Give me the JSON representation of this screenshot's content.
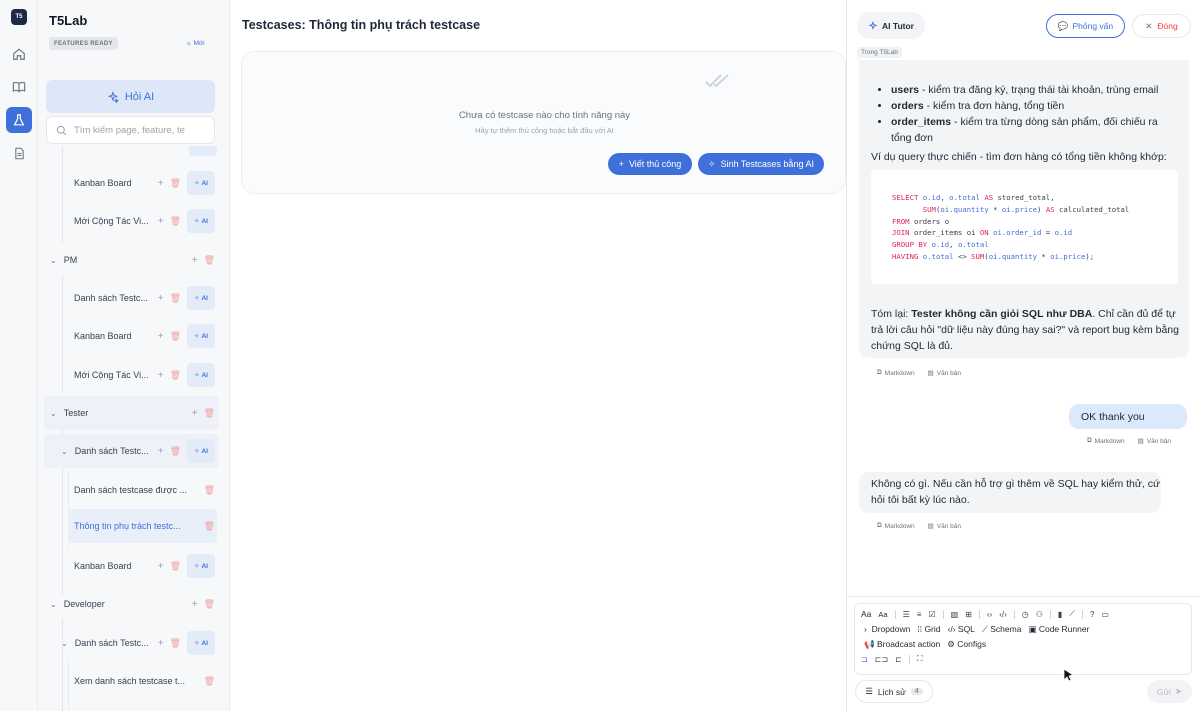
{
  "app": {
    "name": "T5Lab",
    "logo_text": "T5",
    "features_badge": "FEATURES READY",
    "new_badge": "Mới"
  },
  "rail": {
    "items": [
      "home-icon",
      "book-icon",
      "flask-icon",
      "document-icon"
    ]
  },
  "sidebar": {
    "ask_ai": "Hỏi AI",
    "search_placeholder": "Tìm kiếm page, feature, te",
    "ai_label": "AI",
    "rows": [
      {
        "label": "Kanban Board"
      },
      {
        "label": "Mới Cộng Tác Vi..."
      },
      {
        "label": "PM"
      },
      {
        "label": "Danh sách Testc..."
      },
      {
        "label": "Kanban Board"
      },
      {
        "label": "Mới Cộng Tác Vi..."
      },
      {
        "label": "Tester"
      },
      {
        "label": "Danh sách Testc..."
      },
      {
        "label": "Danh sách testcase được ..."
      },
      {
        "label": "Thông tin phụ trách testc..."
      },
      {
        "label": "Kanban Board"
      },
      {
        "label": "Developer"
      },
      {
        "label": "Danh sách Testc..."
      },
      {
        "label": "Xem danh sách testcase t..."
      }
    ]
  },
  "main": {
    "title": "Testcases: Thông tin phụ trách testcase",
    "empty_title": "Chưa có testcase nào cho tính năng này",
    "empty_sub": "Hãy tự thêm thủ công hoặc bắt đầu với AI",
    "manual_button": "Viết thủ công",
    "ai_button": "Sinh Testcases bằng AI"
  },
  "panel": {
    "tutor": "AI Tutor",
    "interview": "Phỏng vấn",
    "close": "Đóng",
    "context": "Trong T5Lab",
    "msg1": {
      "bullets": [
        {
          "term": "users",
          "text": " - kiểm tra đăng ký, trạng thái tài khoản, trùng email"
        },
        {
          "term": "orders",
          "text": " - kiểm tra đơn hàng, tổng tiền"
        },
        {
          "term": "order_items",
          "text": " - kiểm tra từng dòng sản phẩm, đối chiếu ra tổng đơn"
        }
      ],
      "intro": "Ví dụ query thực chiến - tìm đơn hàng có tổng tiền không khớp:",
      "summary_prefix": "Tóm lại: ",
      "summary_bold": "Tester không cần giỏi SQL như DBA",
      "summary_rest": ". Chỉ cần đủ để tự trả lời câu hỏi \"dữ liệu này đúng hay sai?\" và report bug kèm bằng chứng SQL là đủ."
    },
    "code_lines": [
      "SELECT o.id, o.total AS stored_total,",
      "       SUM(oi.quantity * oi.price) AS calculated_total",
      "FROM orders o",
      "JOIN order_items oi ON oi.order_id = o.id",
      "GROUP BY o.id, o.total",
      "HAVING o.total <> SUM(oi.quantity * oi.price);"
    ],
    "markdown": "Markdown",
    "text": "Văn bản",
    "user_msg": "OK thank you",
    "msg2": "Không có gì. Nếu cần hỗ trợ gì thêm về SQL hay kiểm thử, cứ hỏi tôi bất kỳ lúc nào.",
    "toolbar": {
      "font_a": "Aa",
      "font_a2": "Aa",
      "dropdown": "Dropdown",
      "grid": "Grid",
      "sql": "SQL",
      "schema": "Schema",
      "code_runner": "Code Runner",
      "broadcast": "Broadcast action",
      "configs": "Configs"
    },
    "history": "Lịch sử",
    "history_count": "4",
    "send": "Gửi"
  }
}
